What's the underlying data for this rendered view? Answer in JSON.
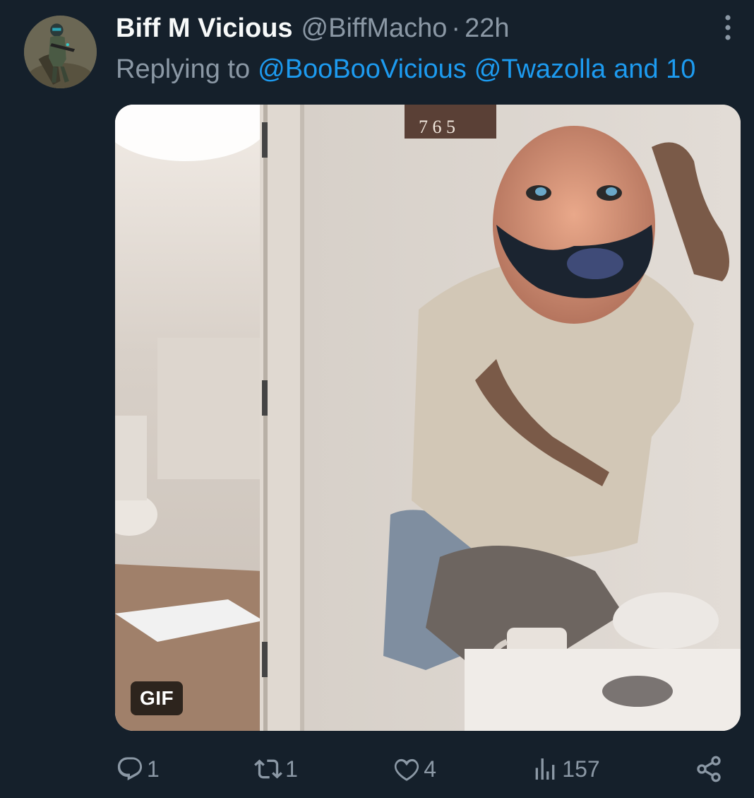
{
  "tweet": {
    "display_name": "Biff M Vicious",
    "handle": "@BiffMacho",
    "separator": "·",
    "time": "22h",
    "replying_prefix": "Replying to",
    "mentions": [
      "@BooBooVicious",
      "@Twazolla"
    ],
    "mentions_suffix": "and 10",
    "media": {
      "badge": "GIF",
      "icon": "gif-media"
    }
  },
  "actions": {
    "reply": {
      "icon": "reply-icon",
      "count": "1"
    },
    "retweet": {
      "icon": "retweet-icon",
      "count": "1"
    },
    "like": {
      "icon": "heart-icon",
      "count": "4"
    },
    "views": {
      "icon": "views-icon",
      "count": "157"
    },
    "share": {
      "icon": "share-icon"
    }
  },
  "colors": {
    "background": "#15202b",
    "text_primary": "#f7f9f9",
    "text_secondary": "#8b98a5",
    "accent": "#1d9bf0"
  }
}
